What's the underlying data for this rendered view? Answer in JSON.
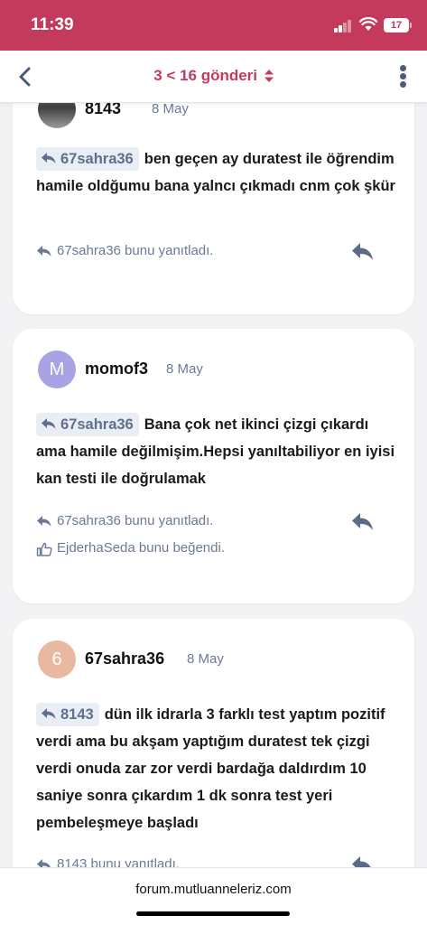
{
  "status_bar": {
    "time": "11:39",
    "battery": "17"
  },
  "header": {
    "title": "3 < 16 gönderi"
  },
  "posts": [
    {
      "username": "8143",
      "date": "8 May",
      "quote_user": "67sahra36",
      "body": "ben geçen ay duratest ile öğrendim hamile oldğumu bana yalncı çıkmadı cnm çok şkür",
      "replied_text": "67sahra36 bunu yanıtladı."
    },
    {
      "avatar_letter": "M",
      "username": "momof3",
      "date": "8 May",
      "quote_user": "67sahra36",
      "body": "Bana çok net ikinci çizgi çıkardı ama hamile değilmişim.Hepsi yanıltabiliyor en iyisi kan testi ile doğrulamak",
      "replied_text": "67sahra36 bunu yanıtladı.",
      "liked_text": "EjderhaSeda bunu beğendi."
    },
    {
      "avatar_letter": "6",
      "username": "67sahra36",
      "date": "8 May",
      "quote_user": "8143",
      "body": "dün ilk idrarla 3 farklı test yaptım pozitif verdi ama bu akşam yaptığım duratest tek çizgi verdi onuda zar zor verdi bardağa daldırdım 10 saniye sonra çıkardım 1 dk sonra test yeri pembeleşmeye başladı",
      "replied_text": "8143 bunu yanıtladı."
    }
  ],
  "footer": {
    "site": "forum.mutluanneleriz.com"
  },
  "colors": {
    "brand": "#c43a5c",
    "muted": "#6b7a94",
    "chip_bg": "#e9eef5",
    "avatar_m": "#a9a3e6",
    "avatar_6": "#e8b8a0"
  }
}
